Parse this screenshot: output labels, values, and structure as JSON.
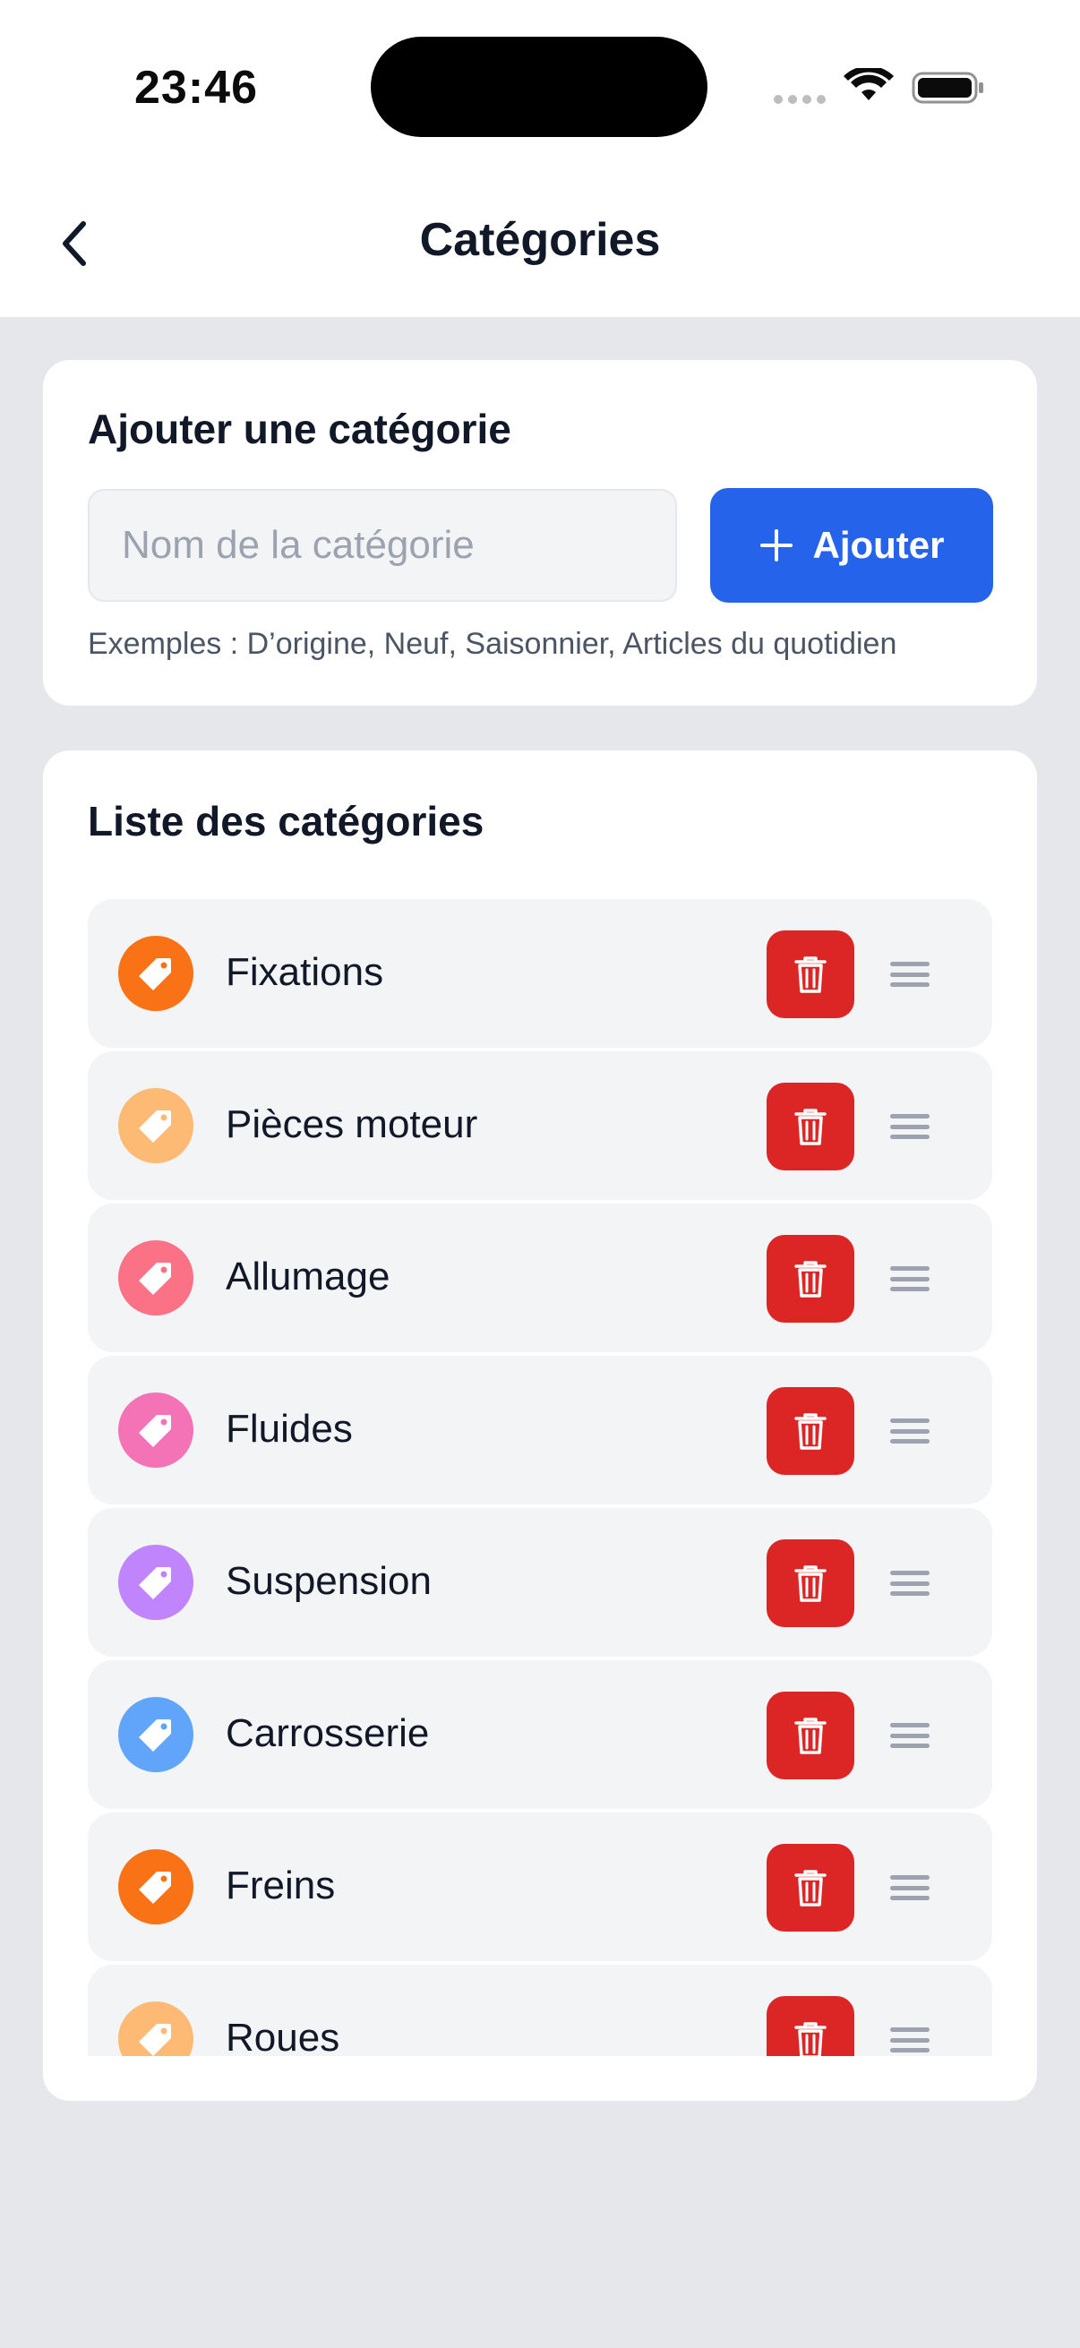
{
  "status_bar": {
    "time": "23:46"
  },
  "nav": {
    "title": "Catégories"
  },
  "add_section": {
    "title": "Ajouter une catégorie",
    "input_value": "",
    "input_placeholder": "Nom de la catégorie",
    "add_button_label": "Ajouter",
    "examples": "Exemples : D’origine, Neuf, Saisonnier, Articles du quotidien"
  },
  "list_section": {
    "title": "Liste des catégories",
    "items": [
      {
        "label": "Fixations",
        "color": "#F97316"
      },
      {
        "label": "Pièces moteur",
        "color": "#FDBA74"
      },
      {
        "label": "Allumage",
        "color": "#FB7185"
      },
      {
        "label": "Fluides",
        "color": "#F472B6"
      },
      {
        "label": "Suspension",
        "color": "#C084FC"
      },
      {
        "label": "Carrosserie",
        "color": "#60A5FA"
      },
      {
        "label": "Freins",
        "color": "#F97316"
      },
      {
        "label": "Roues",
        "color": "#FDBA74"
      }
    ]
  },
  "colors": {
    "primary": "#2563EB",
    "danger": "#DC2626",
    "background": "#E5E7EB",
    "card": "#FFFFFF",
    "row": "#F3F4F6"
  }
}
